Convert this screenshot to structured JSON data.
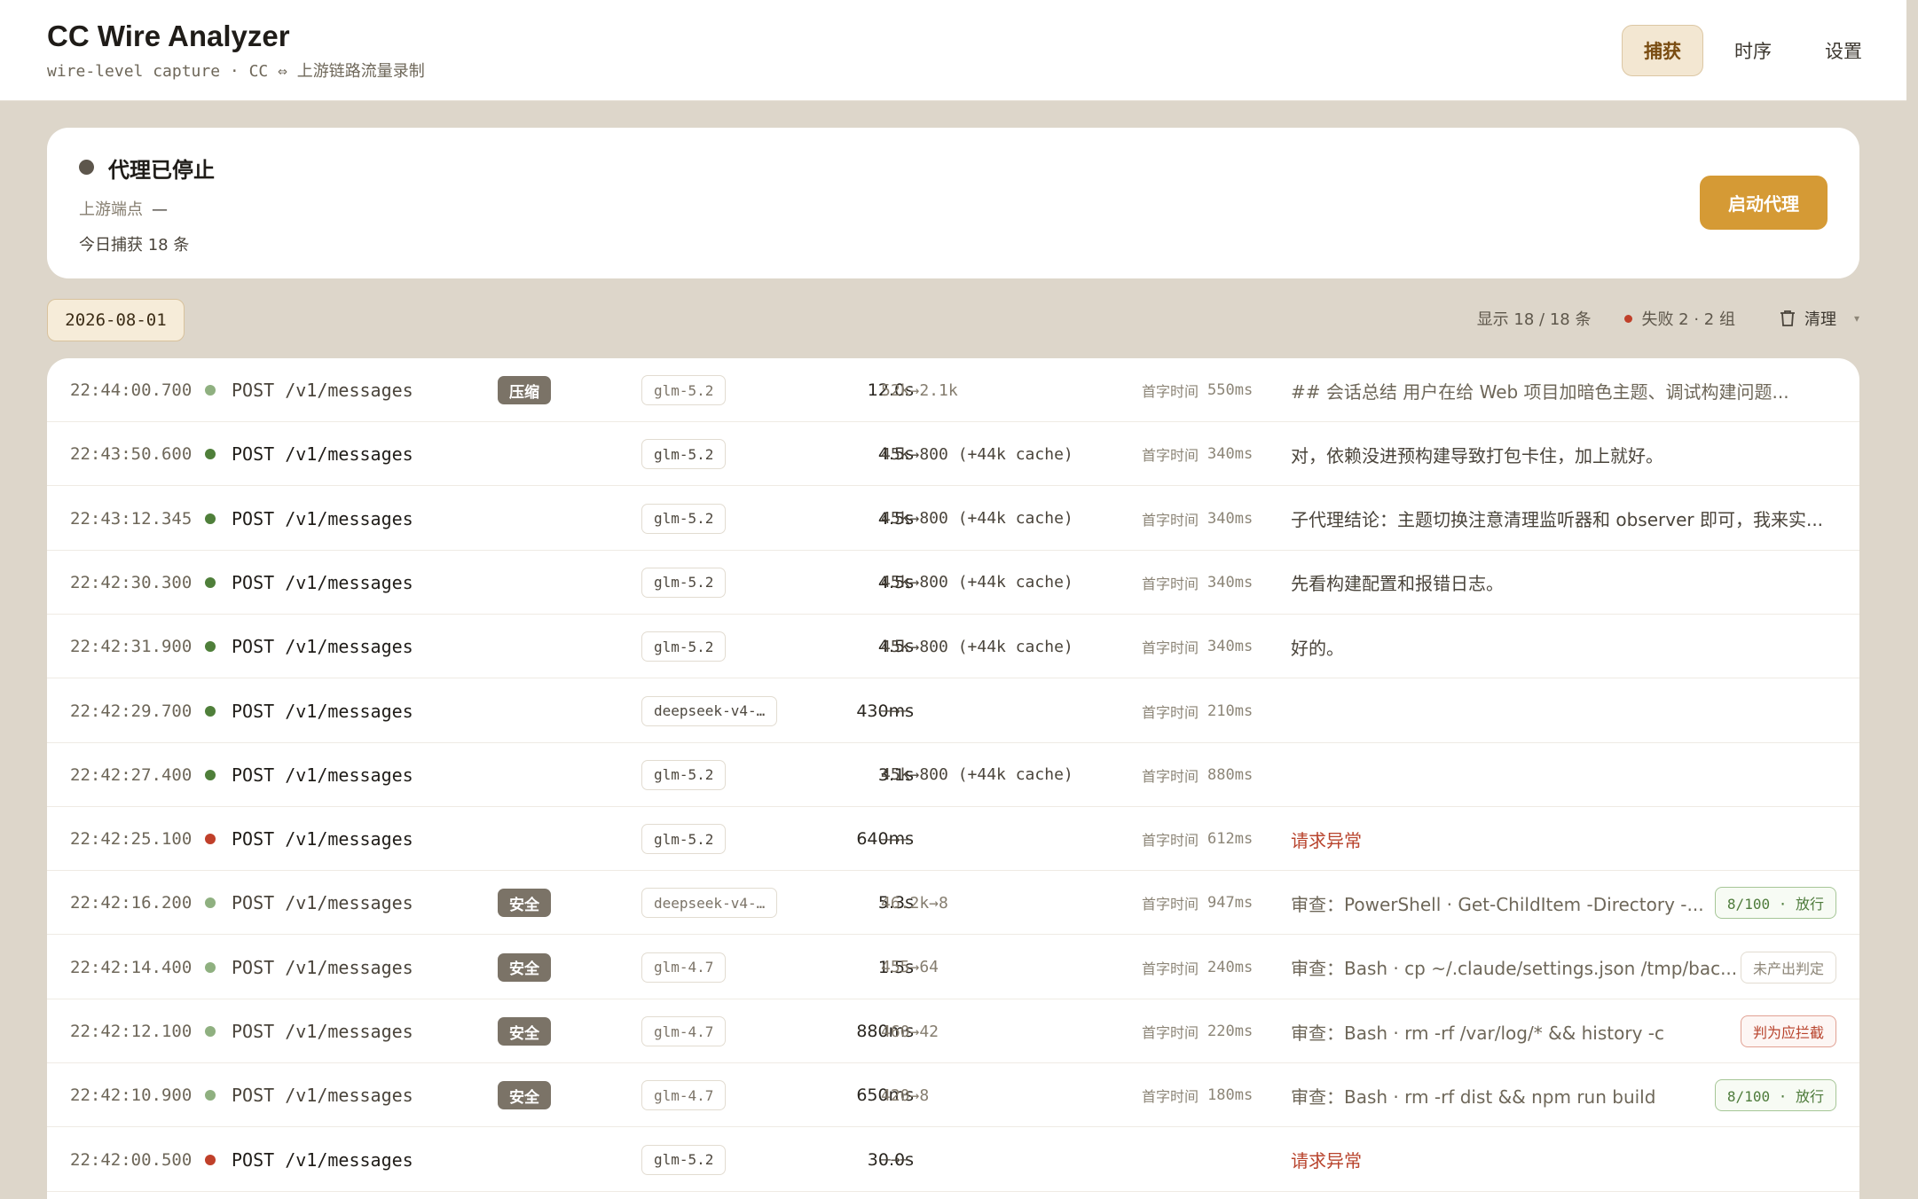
{
  "header": {
    "title": "CC Wire Analyzer",
    "subtitle": "wire-level capture · CC ⇔ 上游链路流量录制",
    "tabs": [
      {
        "label": "捕获",
        "active": true
      },
      {
        "label": "时序",
        "active": false
      },
      {
        "label": "设置",
        "active": false
      }
    ]
  },
  "status": {
    "title": "代理已停止",
    "upstream_label": "上游端点",
    "upstream_value": "—",
    "captured_today": "今日捕获 18 条",
    "start_label": "启动代理"
  },
  "toolbar": {
    "date": "2026-08-01",
    "showing": "显示 18 / 18 条",
    "fail": "失败 2 · 2 组",
    "clear_label": "清理"
  },
  "colors": {
    "ok_dot": "#4f7f3a",
    "ok_dim_dot": "#8fb080",
    "err_dot": "#c0402a",
    "accent": "#d59a35"
  },
  "ttfb_label": "首字时间",
  "rows": [
    {
      "time": "22:44:00.700",
      "status": "ok-dim",
      "method": "POST /v1/messages",
      "tag": "压缩",
      "model": "glm-5.2",
      "duration": "12.0s",
      "tokens": "52k→2.1k",
      "ttfb": "550ms",
      "summary": "## 会话总结 用户在给 Web 项目加暗色主题、调试构建问题...",
      "summary_err": false,
      "badge": "",
      "badge_type": ""
    },
    {
      "time": "22:43:50.600",
      "status": "ok",
      "method": "POST /v1/messages",
      "tag": "",
      "model": "glm-5.2",
      "duration": "4.5s",
      "tokens": "45k→800 (+44k cache)",
      "ttfb": "340ms",
      "summary": "对，依赖没进预构建导致打包卡住，加上就好。",
      "summary_err": false,
      "badge": "",
      "badge_type": ""
    },
    {
      "time": "22:43:12.345",
      "status": "ok",
      "method": "POST /v1/messages",
      "tag": "",
      "model": "glm-5.2",
      "duration": "4.5s",
      "tokens": "45k→800 (+44k cache)",
      "ttfb": "340ms",
      "summary": "子代理结论：主题切换注意清理监听器和 observer 即可，我来实...",
      "summary_err": false,
      "badge": "",
      "badge_type": ""
    },
    {
      "time": "22:42:30.300",
      "status": "ok",
      "method": "POST /v1/messages",
      "tag": "",
      "model": "glm-5.2",
      "duration": "4.5s",
      "tokens": "45k→800 (+44k cache)",
      "ttfb": "340ms",
      "summary": "先看构建配置和报错日志。",
      "summary_err": false,
      "badge": "",
      "badge_type": ""
    },
    {
      "time": "22:42:31.900",
      "status": "ok",
      "method": "POST /v1/messages",
      "tag": "",
      "model": "glm-5.2",
      "duration": "4.5s",
      "tokens": "45k→800 (+44k cache)",
      "ttfb": "340ms",
      "summary": "好的。",
      "summary_err": false,
      "badge": "",
      "badge_type": ""
    },
    {
      "time": "22:42:29.700",
      "status": "ok",
      "method": "POST /v1/messages",
      "tag": "",
      "model": "deepseek-v4-…",
      "duration": "430ms",
      "tokens": "—→—",
      "ttfb": "210ms",
      "summary": "",
      "summary_err": false,
      "badge": "",
      "badge_type": ""
    },
    {
      "time": "22:42:27.400",
      "status": "ok",
      "method": "POST /v1/messages",
      "tag": "",
      "model": "glm-5.2",
      "duration": "3.1s",
      "tokens": "45k→800 (+44k cache)",
      "ttfb": "880ms",
      "summary": "",
      "summary_err": false,
      "badge": "",
      "badge_type": ""
    },
    {
      "time": "22:42:25.100",
      "status": "err",
      "method": "POST /v1/messages",
      "tag": "",
      "model": "glm-5.2",
      "duration": "640ms",
      "tokens": "—→—",
      "ttfb": "612ms",
      "summary": "请求异常",
      "summary_err": true,
      "badge": "",
      "badge_type": ""
    },
    {
      "time": "22:42:16.200",
      "status": "ok-dim",
      "method": "POST /v1/messages",
      "tag": "安全",
      "model": "deepseek-v4-…",
      "duration": "5.3s",
      "tokens": "46.2k→8",
      "ttfb": "947ms",
      "summary": "审查：PowerShell · Get-ChildItem -Directory -...",
      "summary_err": false,
      "badge": "8/100 · 放行",
      "badge_type": "pass"
    },
    {
      "time": "22:42:14.400",
      "status": "ok-dim",
      "method": "POST /v1/messages",
      "tag": "安全",
      "model": "glm-4.7",
      "duration": "1.5s",
      "tokens": "455→64",
      "ttfb": "240ms",
      "summary": "审查：Bash · cp ~/.claude/settings.json /tmp/bac...",
      "summary_err": false,
      "badge": "未产出判定",
      "badge_type": "none"
    },
    {
      "time": "22:42:12.100",
      "status": "ok-dim",
      "method": "POST /v1/messages",
      "tag": "安全",
      "model": "glm-4.7",
      "duration": "880ms",
      "tokens": "460→42",
      "ttfb": "220ms",
      "summary": "审查：Bash · rm -rf /var/log/* && history -c",
      "summary_err": false,
      "badge": "判为应拦截",
      "badge_type": "block"
    },
    {
      "time": "22:42:10.900",
      "status": "ok-dim",
      "method": "POST /v1/messages",
      "tag": "安全",
      "model": "glm-4.7",
      "duration": "650ms",
      "tokens": "420→8",
      "ttfb": "180ms",
      "summary": "审查：Bash · rm -rf dist && npm run build",
      "summary_err": false,
      "badge": "8/100 · 放行",
      "badge_type": "pass"
    },
    {
      "time": "22:42:00.500",
      "status": "err",
      "method": "POST /v1/messages",
      "tag": "",
      "model": "glm-5.2",
      "duration": "30.0s",
      "tokens": "—→—",
      "ttfb": "",
      "summary": "请求异常",
      "summary_err": true,
      "badge": "",
      "badge_type": ""
    }
  ]
}
